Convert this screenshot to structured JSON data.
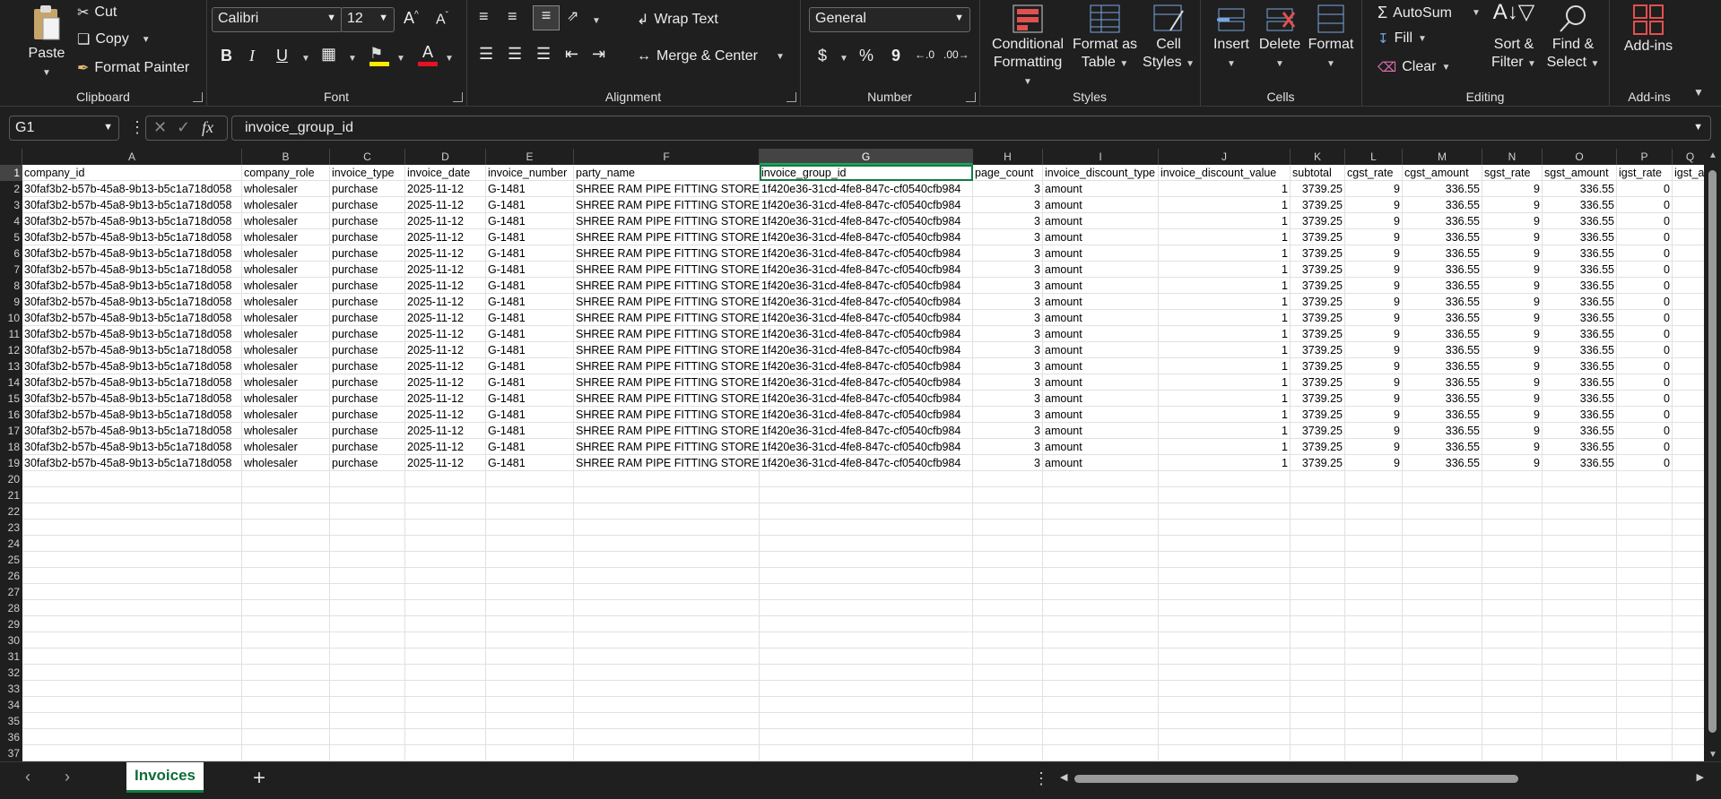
{
  "ribbon": {
    "clipboard": {
      "label": "Clipboard",
      "paste": "Paste",
      "cut": "Cut",
      "copy": "Copy",
      "format_painter": "Format Painter"
    },
    "font": {
      "label": "Font",
      "font_name": "Calibri",
      "font_size": "12",
      "bold": "B",
      "italic": "I",
      "underline": "U"
    },
    "alignment": {
      "label": "Alignment",
      "wrap_text": "Wrap Text",
      "merge_center": "Merge & Center"
    },
    "number": {
      "label": "Number",
      "format": "General",
      "currency": "$",
      "percent": "%",
      "comma": "9"
    },
    "styles": {
      "label": "Styles",
      "conditional_1": "Conditional",
      "conditional_2": "Formatting",
      "format_table_1": "Format as",
      "format_table_2": "Table",
      "cell_styles_1": "Cell",
      "cell_styles_2": "Styles"
    },
    "cells": {
      "label": "Cells",
      "insert": "Insert",
      "delete": "Delete",
      "format": "Format"
    },
    "editing": {
      "label": "Editing",
      "autosum": "AutoSum",
      "fill": "Fill",
      "clear": "Clear",
      "sort_1": "Sort &",
      "sort_2": "Filter",
      "find_1": "Find &",
      "find_2": "Select"
    },
    "addins": {
      "label": "Add-ins",
      "addins": "Add-ins"
    }
  },
  "formula_bar": {
    "name_box": "G1",
    "fx": "fx",
    "content": "invoice_group_id"
  },
  "columns": [
    "A",
    "B",
    "C",
    "D",
    "E",
    "F",
    "G",
    "H",
    "I",
    "J",
    "K",
    "L",
    "M",
    "N",
    "O",
    "P",
    "Q"
  ],
  "headers": [
    "company_id",
    "company_role",
    "invoice_type",
    "invoice_date",
    "invoice_number",
    "party_name",
    "invoice_group_id",
    "page_count",
    "invoice_discount_type",
    "invoice_discount_value",
    "subtotal",
    "cgst_rate",
    "cgst_amount",
    "sgst_rate",
    "sgst_amount",
    "igst_rate",
    "igst_a"
  ],
  "row_values": {
    "company_id": "30faf3b2-b57b-45a8-9b13-b5c1a718d058",
    "company_role": "wholesaler",
    "invoice_type": "purchase",
    "invoice_date": "2025-11-12",
    "invoice_number": "G-1481",
    "party_name": "SHREE RAM PIPE FITTING STORES",
    "invoice_group_id": "1f420e36-31cd-4fe8-847c-cf0540cfb984",
    "page_count": "3",
    "invoice_discount_type": "amount",
    "invoice_discount_value": "1",
    "subtotal": "3739.25",
    "cgst_rate": "9",
    "cgst_amount": "336.55",
    "sgst_rate": "9",
    "sgst_amount": "336.55",
    "igst_rate": "0"
  },
  "data_row_count": 18,
  "visible_rows": 38,
  "sheet_tab": "Invoices",
  "active_cell": "G1"
}
